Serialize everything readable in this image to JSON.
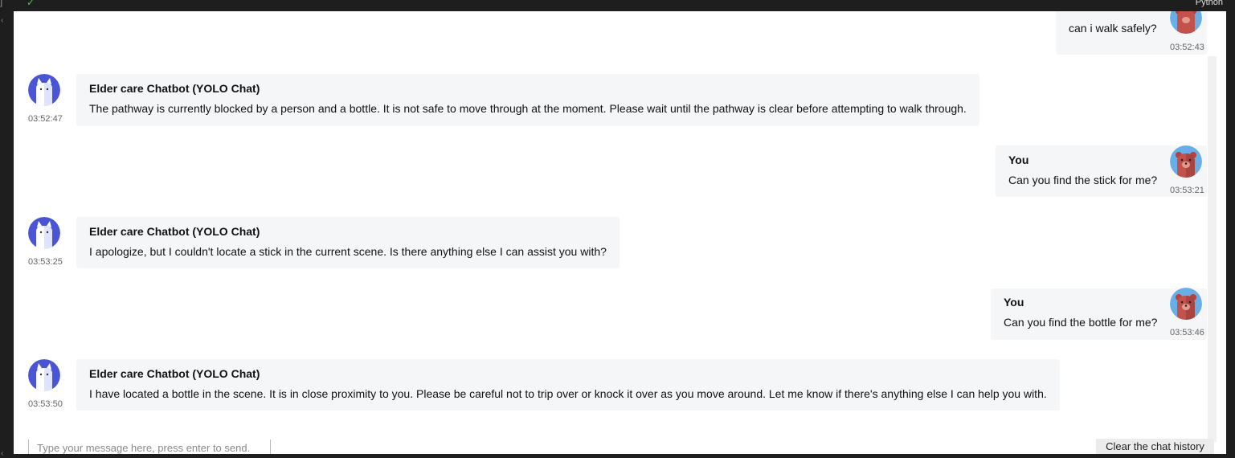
{
  "topbar": {
    "bracket": "]",
    "check": "✓",
    "language": "Python"
  },
  "bot_name": "Elder care Chatbot (YOLO Chat)",
  "user_name": "You",
  "messages": [
    {
      "from": "user",
      "name": "",
      "text": "can i walk safely?",
      "time": "03:52:43"
    },
    {
      "from": "bot",
      "name": "Elder care Chatbot (YOLO Chat)",
      "text": "The pathway is currently blocked by a person and a bottle. It is not safe to move through at the moment. Please wait until the pathway is clear before attempting to walk through.",
      "time": "03:52:47"
    },
    {
      "from": "user",
      "name": "You",
      "text": "Can you find the stick for me?",
      "time": "03:53:21"
    },
    {
      "from": "bot",
      "name": "Elder care Chatbot (YOLO Chat)",
      "text": "I apologize, but I couldn't locate a stick in the current scene. Is there anything else I can assist you with?",
      "time": "03:53:25"
    },
    {
      "from": "user",
      "name": "You",
      "text": "Can you find the bottle for me?",
      "time": "03:53:46"
    },
    {
      "from": "bot",
      "name": "Elder care Chatbot (YOLO Chat)",
      "text": "I have located a bottle in the scene. It is in close proximity to you. Please be careful not to trip over or knock it over as you move around. Let me know if there's anything else I can help you with.",
      "time": "03:53:50"
    }
  ],
  "input": {
    "placeholder": "Type your message here, press enter to send.",
    "value": ""
  },
  "clear_button": "Clear the chat history",
  "colors": {
    "bot_avatar_bg": "#4a55d6",
    "user_avatar_bg": "#6aaee8",
    "bubble_bg": "#f5f6f8"
  }
}
